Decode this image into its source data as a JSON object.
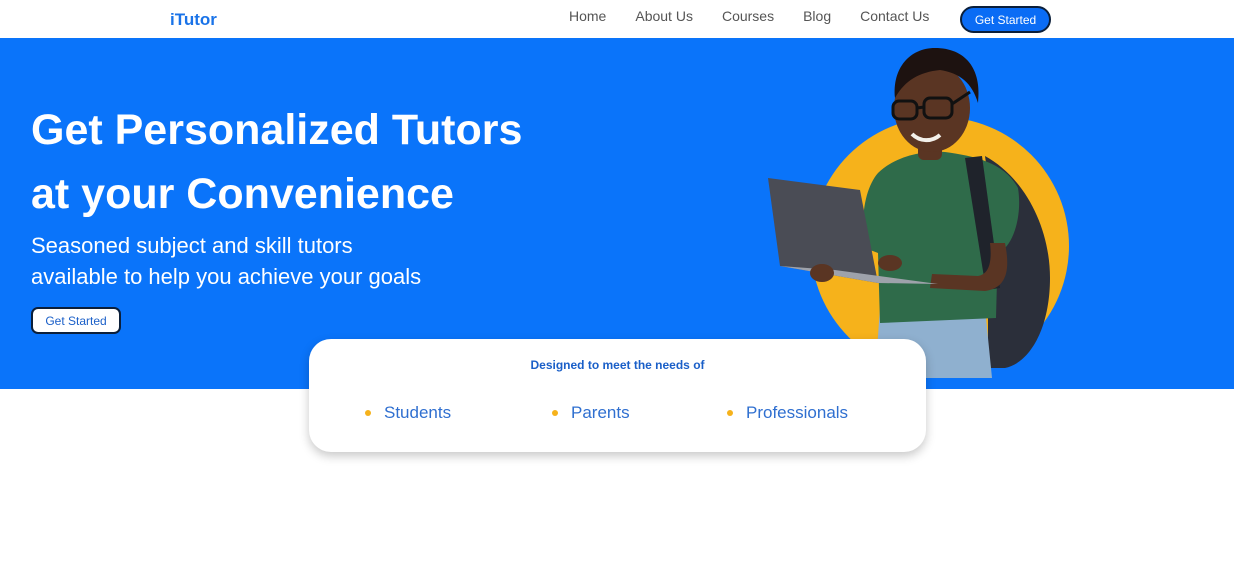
{
  "header": {
    "logo": "iTutor",
    "nav": [
      {
        "label": "Home"
      },
      {
        "label": "About Us"
      },
      {
        "label": "Courses"
      },
      {
        "label": "Blog"
      },
      {
        "label": "Contact Us"
      }
    ],
    "cta_label": "Get Started"
  },
  "hero": {
    "title_line1": "Get Personalized Tutors",
    "title_line2": "at your Convenience",
    "subtitle_line1": "Seasoned subject and skill tutors",
    "subtitle_line2": "available to help you achieve your goals",
    "button_label": "Get Started",
    "colors": {
      "background": "#0a74fa",
      "accent_circle": "#f6b21b"
    }
  },
  "audience": {
    "title": "Designed to meet the needs of",
    "items": [
      {
        "label": "Students"
      },
      {
        "label": "Parents"
      },
      {
        "label": "Professionals"
      }
    ]
  }
}
